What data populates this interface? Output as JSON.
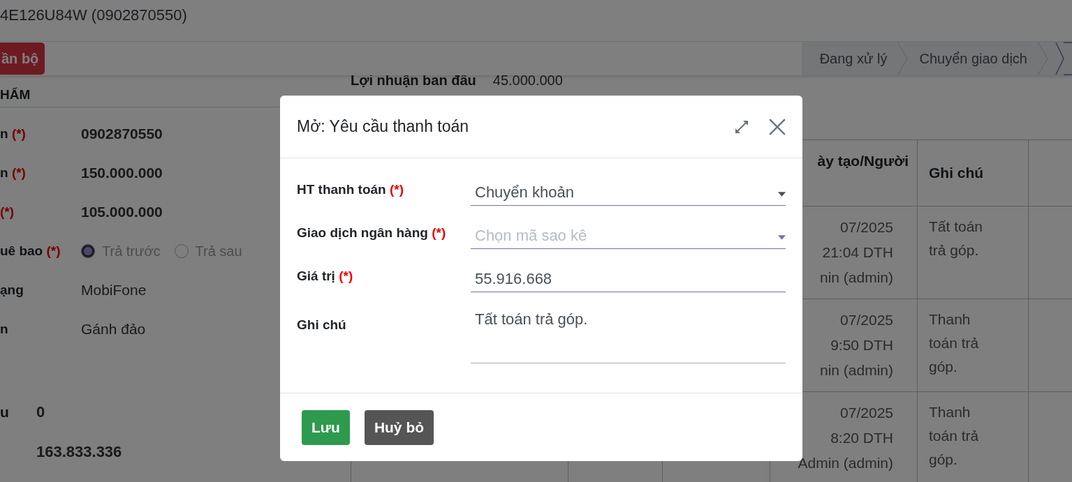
{
  "record_title": "4E126U84W (0902870550)",
  "toolbar": {
    "button": "ần bộ",
    "stages": [
      {
        "label": "Đang xử lý",
        "selected": false
      },
      {
        "label": "Chuyển giao dịch",
        "selected": false
      }
    ]
  },
  "form": {
    "section": "HẨM",
    "fields": [
      {
        "kind": "text",
        "label": "n",
        "required": "(*)",
        "value": "0902870550"
      },
      {
        "kind": "text",
        "label": "n",
        "required": "(*)",
        "value": "150.000.000"
      },
      {
        "kind": "text",
        "required": "(*)",
        "value": "105.000.000"
      },
      {
        "kind": "radio",
        "label": "uê bao",
        "required": "(*)",
        "options": [
          {
            "label": "Trả trước",
            "selected": true
          },
          {
            "label": "Trả sau",
            "selected": false
          }
        ]
      },
      {
        "kind": "plain",
        "label": "ạng",
        "value": "MobiFone"
      },
      {
        "kind": "plain",
        "label": "n",
        "value": "Gánh đảo"
      }
    ],
    "totals": [
      {
        "label": "u",
        "value": "0"
      },
      {
        "value": "163.833.336"
      }
    ]
  },
  "profit": {
    "label": "Lợi nhuận ban đầu",
    "value": "45.000.000"
  },
  "table": {
    "columns": [
      "ày tạo/Người",
      "Ghi chú"
    ],
    "rows": [
      {
        "created": [
          "07/2025",
          "21:04 DTH",
          "nin (admin)"
        ],
        "note": "Tất toán trả góp."
      },
      {
        "created": [
          "07/2025",
          "9:50 DTH",
          "nin (admin)"
        ],
        "note": "Thanh toán trả góp."
      },
      {
        "created": [
          "07/2025",
          "8:20 DTH",
          "Admin (admin)"
        ],
        "note": "Thanh toán trả góp."
      }
    ]
  },
  "dialog": {
    "title": "Mở: Yêu cầu thanh toán",
    "fields": [
      {
        "kind": "select",
        "label": "HT thanh toán",
        "required": "(*)",
        "value": "Chuyển khoản"
      },
      {
        "kind": "select",
        "label": "Giao dịch ngân hàng",
        "required": "(*)",
        "placeholder": "Chọn mã sao kê"
      },
      {
        "kind": "input",
        "label": "Giá trị",
        "required": "(*)",
        "value": "55.916.668"
      },
      {
        "kind": "textarea",
        "label": "Ghi chú",
        "value": "Tất toán trả góp."
      }
    ],
    "buttons": [
      {
        "label": "Lưu",
        "kind": "primary"
      },
      {
        "label": "Huỷ bỏ",
        "kind": "secondary"
      }
    ]
  }
}
